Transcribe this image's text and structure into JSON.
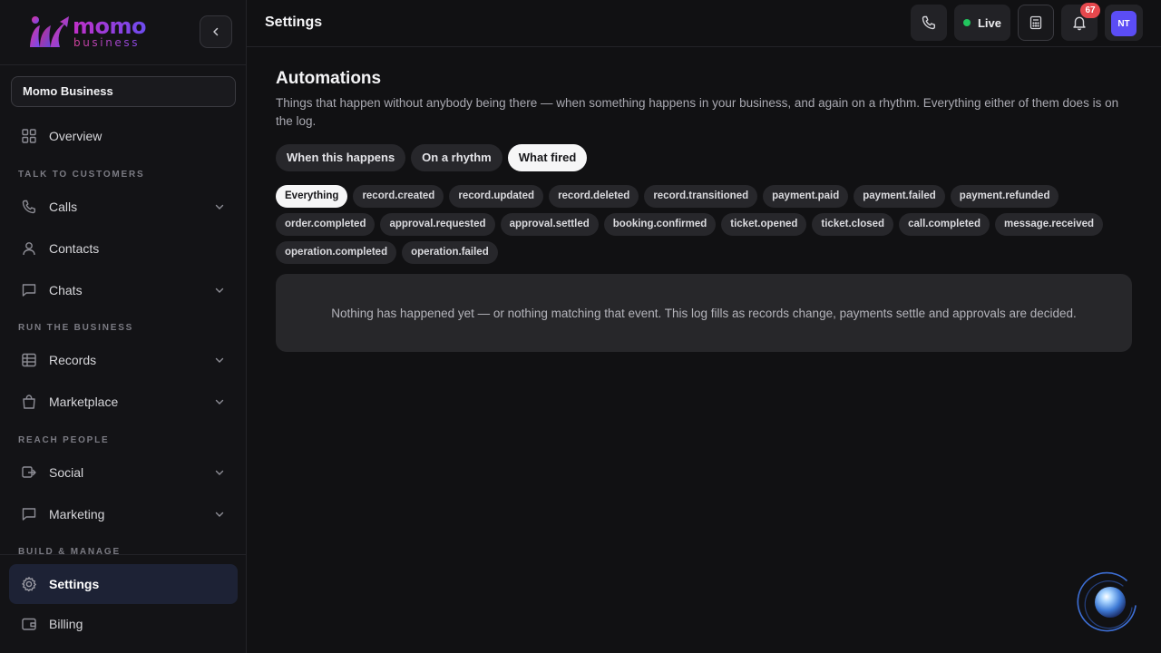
{
  "brand": {
    "name": "momo",
    "tagline": "business"
  },
  "workspace": {
    "name": "Momo Business"
  },
  "sidebar": {
    "overview": {
      "label": "Overview",
      "icon": "grid-icon"
    },
    "sections": [
      {
        "label": "TALK TO CUSTOMERS"
      },
      {
        "label": "RUN THE BUSINESS"
      },
      {
        "label": "REACH PEOPLE"
      },
      {
        "label": "BUILD & MANAGE"
      }
    ],
    "items": [
      {
        "label": "Calls",
        "icon": "phone-icon",
        "expandable": true
      },
      {
        "label": "Contacts",
        "icon": "user-icon",
        "expandable": false
      },
      {
        "label": "Chats",
        "icon": "chat-icon",
        "expandable": true
      },
      {
        "label": "Records",
        "icon": "table-icon",
        "expandable": true
      },
      {
        "label": "Marketplace",
        "icon": "bag-icon",
        "expandable": true
      },
      {
        "label": "Social",
        "icon": "share-icon",
        "expandable": true
      },
      {
        "label": "Marketing",
        "icon": "message-icon",
        "expandable": true
      }
    ],
    "bottom": [
      {
        "label": "Settings",
        "icon": "gear-icon",
        "active": true
      },
      {
        "label": "Billing",
        "icon": "wallet-icon",
        "active": false
      }
    ]
  },
  "header": {
    "title": "Settings",
    "live_label": "Live",
    "notification_count": "67",
    "avatar_initials": "NT"
  },
  "main": {
    "title": "Automations",
    "description": "Things that happen without anybody being there — when something happens in your business, and again on a rhythm. Everything either of them does is on the log.",
    "tabs": [
      {
        "label": "When this happens",
        "active": false
      },
      {
        "label": "On a rhythm",
        "active": false
      },
      {
        "label": "What fired",
        "active": true
      }
    ],
    "event_filters": [
      {
        "label": "Everything",
        "active": true
      },
      {
        "label": "record.created"
      },
      {
        "label": "record.updated"
      },
      {
        "label": "record.deleted"
      },
      {
        "label": "record.transitioned"
      },
      {
        "label": "payment.paid"
      },
      {
        "label": "payment.failed"
      },
      {
        "label": "payment.refunded"
      },
      {
        "label": "order.completed"
      },
      {
        "label": "approval.requested"
      },
      {
        "label": "approval.settled"
      },
      {
        "label": "booking.confirmed"
      },
      {
        "label": "ticket.opened"
      },
      {
        "label": "ticket.closed"
      },
      {
        "label": "call.completed"
      },
      {
        "label": "message.received"
      },
      {
        "label": "operation.completed"
      },
      {
        "label": "operation.failed"
      }
    ],
    "empty_state": "Nothing has happened yet — or nothing matching that event. This log fills as records change, payments settle and approvals are decided."
  },
  "colors": {
    "background": "#111113",
    "accent": "#5b4df5",
    "live": "#22c55e",
    "badge": "#e5484d",
    "active_nav": "#1d2235"
  }
}
